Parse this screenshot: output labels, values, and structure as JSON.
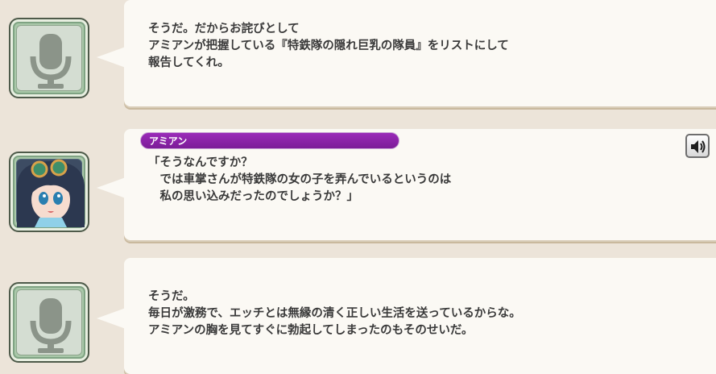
{
  "log_entries": [
    {
      "speaker": "",
      "avatar": "microphone-icon",
      "text": "そうだ。だからお詫びとして\nアミアンが把握している『特鉄隊の隠れ巨乳の隊員』をリストにして\n報告してくれ。"
    },
    {
      "speaker": "アミアン",
      "avatar": "character-portrait",
      "has_voice": true,
      "voice_icon": "speaker-icon",
      "text": "「そうなんですか？\n　では車掌さんが特鉄隊の女の子を弄んでいるというのは\n　私の思い込みだったのでしょうか？」"
    },
    {
      "speaker": "",
      "avatar": "microphone-icon",
      "text": "そうだ。\n毎日が激務で、エッチとは無縁の清く正しい生活を送っているからな。\nアミアンの胸を見てすぐに勃起してしまったのもそのせいだ。"
    }
  ],
  "colors": {
    "background": "#ece4d9",
    "bubble": "#fbf9f4",
    "name_plate": "#8a22a8",
    "avatar_frame": "#a9c8a9",
    "text": "#3a3a3a"
  }
}
